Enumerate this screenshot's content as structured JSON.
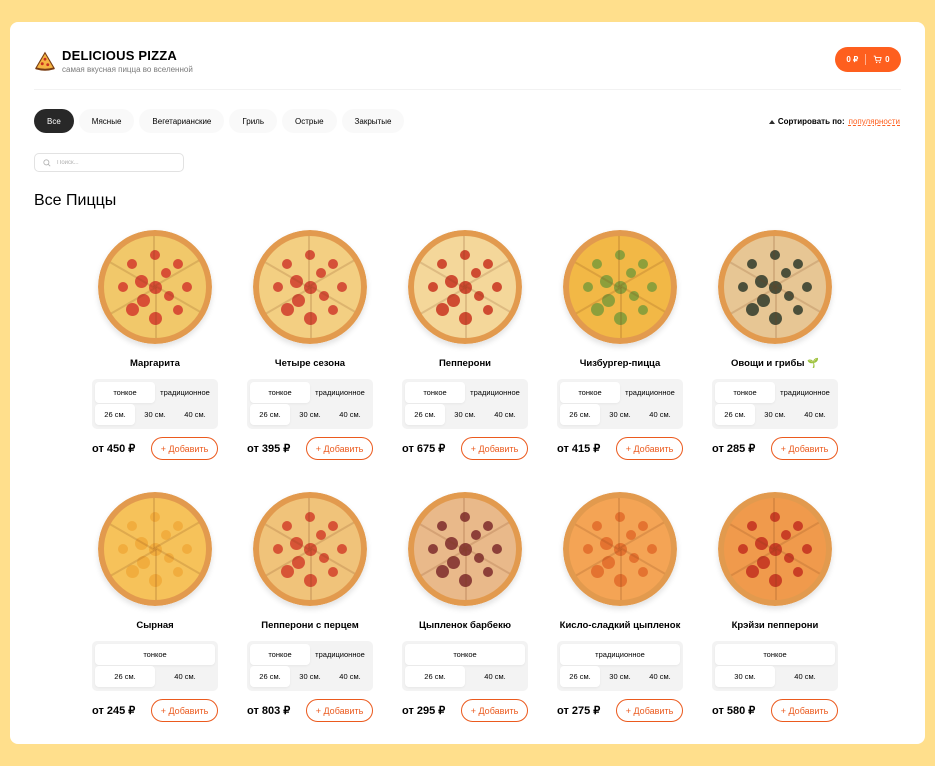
{
  "brand": {
    "title": "DELICIOUS PIZZA",
    "subtitle": "самая вкусная пицца во вселенной"
  },
  "cart": {
    "total": "0 ₽",
    "count": "0"
  },
  "categories": [
    "Все",
    "Мясные",
    "Вегетарианские",
    "Гриль",
    "Острые",
    "Закрытые"
  ],
  "active_category": "Все",
  "sort": {
    "label": "Сортировать по:",
    "value": "популярности"
  },
  "search": {
    "placeholder": "Поиск..."
  },
  "page_title": "Все Пиццы",
  "add_label": "+ Добавить",
  "pizzas": [
    {
      "name": "Маргарита",
      "types": [
        "тонкое",
        "традиционное"
      ],
      "sizes": [
        "26 см.",
        "30 см.",
        "40 см."
      ],
      "price": "от 450 ₽",
      "style": {
        "base": "#f1c86a",
        "topping": "#d33a2c"
      }
    },
    {
      "name": "Четыре сезона",
      "types": [
        "тонкое",
        "традиционное"
      ],
      "sizes": [
        "26 см.",
        "30 см.",
        "40 см."
      ],
      "price": "от 395 ₽",
      "style": {
        "base": "#f3cf82",
        "topping": "#cf3b2b"
      }
    },
    {
      "name": "Пепперони",
      "types": [
        "тонкое",
        "традиционное"
      ],
      "sizes": [
        "26 см.",
        "30 см.",
        "40 см."
      ],
      "price": "от 675 ₽",
      "style": {
        "base": "#f4d79a",
        "topping": "#c8321f"
      }
    },
    {
      "name": "Чизбургер-пицца",
      "types": [
        "тонкое",
        "традиционное"
      ],
      "sizes": [
        "26 см.",
        "30 см.",
        "40 см."
      ],
      "price": "от 415 ₽",
      "style": {
        "base": "#f2b846",
        "topping": "#7b9a3a"
      }
    },
    {
      "name": "Овощи и грибы 🌱",
      "types": [
        "тонкое",
        "традиционное"
      ],
      "sizes": [
        "26 см.",
        "30 см.",
        "40 см."
      ],
      "price": "от 285 ₽",
      "style": {
        "base": "#e7c694",
        "topping": "#2f3a2a"
      }
    },
    {
      "name": "Сырная",
      "types": [
        "тонкое"
      ],
      "sizes": [
        "26 см.",
        "40 см."
      ],
      "price": "от 245 ₽",
      "style": {
        "base": "#f6c25a",
        "topping": "#f0a93a"
      }
    },
    {
      "name": "Пепперони с перцем",
      "types": [
        "тонкое",
        "традиционное"
      ],
      "sizes": [
        "26 см.",
        "30 см.",
        "40 см."
      ],
      "price": "от 803 ₽",
      "style": {
        "base": "#f0c37a",
        "topping": "#d2412a"
      }
    },
    {
      "name": "Цыпленок барбекю",
      "types": [
        "тонкое"
      ],
      "sizes": [
        "26 см.",
        "40 см."
      ],
      "price": "от 295 ₽",
      "style": {
        "base": "#e9b98a",
        "topping": "#7d2a2a"
      }
    },
    {
      "name": "Кисло-сладкий цыпленок",
      "types": [
        "традиционное"
      ],
      "sizes": [
        "26 см.",
        "30 см.",
        "40 см."
      ],
      "price": "от 275 ₽",
      "style": {
        "base": "#f4a455",
        "topping": "#e06b2a"
      }
    },
    {
      "name": "Крэйзи пепперони",
      "types": [
        "тонкое"
      ],
      "sizes": [
        "30 см.",
        "40 см."
      ],
      "price": "от 580 ₽",
      "style": {
        "base": "#f09a4c",
        "topping": "#c22f1e"
      }
    }
  ]
}
